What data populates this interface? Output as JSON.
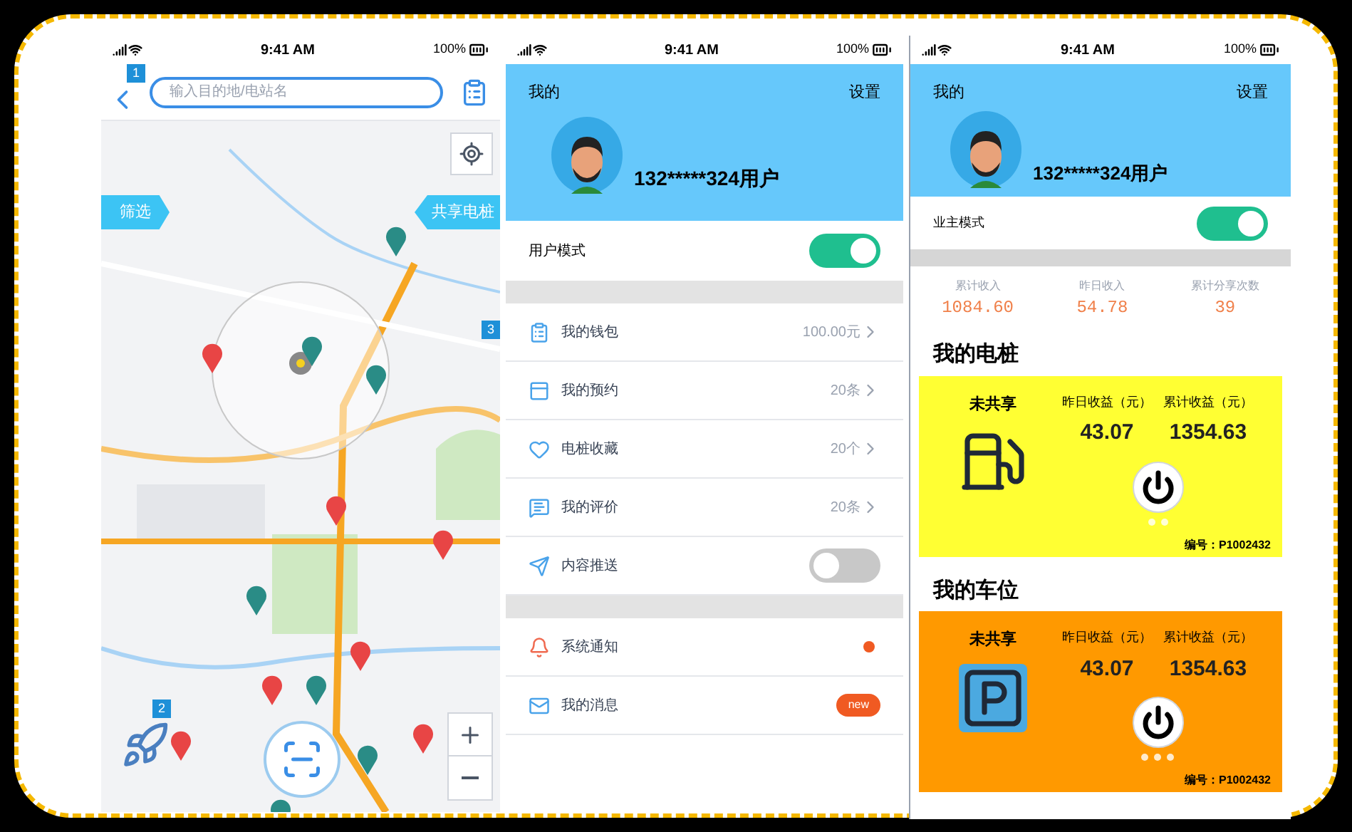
{
  "map_screen": {
    "status_bar": {
      "time": "9:41 AM",
      "battery": "100%"
    },
    "search": {
      "placeholder": "输入目的地/电站名"
    },
    "filter_button": "筛选",
    "share_button": "共享电桩",
    "badges": [
      "1",
      "2",
      "3"
    ],
    "pins": [
      {
        "color": "#2a8c86"
      },
      {
        "color": "#e84545"
      },
      {
        "color": "#2a8c86"
      },
      {
        "color": "#2a8c86"
      },
      {
        "color": "#e84545"
      },
      {
        "color": "#e84545"
      },
      {
        "color": "#2a8c86"
      },
      {
        "color": "#e84545"
      },
      {
        "color": "#e84545"
      },
      {
        "color": "#2a8c86"
      },
      {
        "color": "#e84545"
      },
      {
        "color": "#e84545"
      },
      {
        "color": "#2a8c86"
      },
      {
        "color": "#2a8c86"
      }
    ]
  },
  "user_screen": {
    "status_bar": {
      "time": "9:41 AM",
      "battery": "100%"
    },
    "title": "我的",
    "settings": "设置",
    "username": "132*****324用户",
    "mode": {
      "label": "用户模式",
      "on": true
    },
    "sections": [
      [
        {
          "kind": "link",
          "label": "我的钱包",
          "value": "100.00元"
        },
        {
          "kind": "link",
          "label": "我的预约",
          "value": "20条"
        },
        {
          "kind": "link",
          "label": "电桩收藏",
          "value": "20个"
        },
        {
          "kind": "link",
          "label": "我的评价",
          "value": "20条"
        },
        {
          "kind": "toggle",
          "label": "内容推送",
          "on": false
        }
      ],
      [
        {
          "kind": "dot",
          "label": "系统通知"
        },
        {
          "kind": "badge",
          "label": "我的消息",
          "badge": "new"
        }
      ]
    ]
  },
  "owner_screen": {
    "status_bar": {
      "time": "9:41 AM",
      "battery": "100%"
    },
    "title": "我的",
    "settings": "设置",
    "username": "132*****324用户",
    "mode": {
      "label": "业主模式",
      "on": true
    },
    "stats": [
      {
        "label": "累计收入",
        "value": "1084.60"
      },
      {
        "label": "昨日收入",
        "value": "54.78"
      },
      {
        "label": "累计分享次数",
        "value": "39"
      }
    ],
    "assets": [
      {
        "kind": "charger",
        "heading": "我的电桩",
        "color": "#ffff33",
        "status": "未共享",
        "columns": [
          {
            "label": "昨日收益（元）",
            "value": "43.07"
          },
          {
            "label": "累计收益（元）",
            "value": "1354.63"
          }
        ],
        "code": "编号：P1002432"
      },
      {
        "kind": "parking",
        "heading": "我的车位",
        "color": "#ff9900",
        "status": "未共享",
        "columns": [
          {
            "label": "昨日收益（元）",
            "value": "43.07"
          },
          {
            "label": "累计收益（元）",
            "value": "1354.63"
          }
        ],
        "code": "编号：P1002432"
      }
    ]
  }
}
